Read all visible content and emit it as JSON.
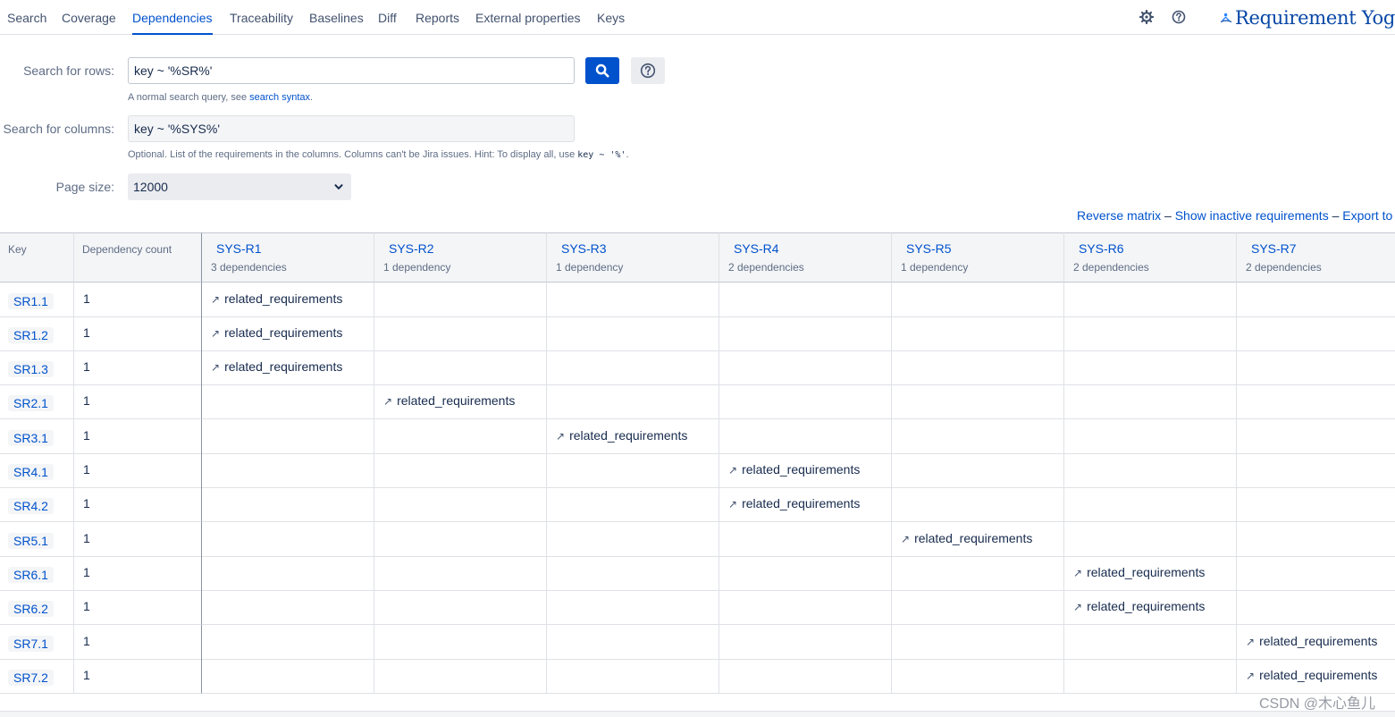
{
  "nav": {
    "tabs": [
      {
        "label": "Search",
        "active": false
      },
      {
        "label": "Coverage",
        "active": false
      },
      {
        "label": "Dependencies",
        "active": true
      },
      {
        "label": "Traceability",
        "active": false
      },
      {
        "label": "Baselines",
        "active": false
      },
      {
        "label": "Diff",
        "active": false
      },
      {
        "label": "Reports",
        "active": false
      },
      {
        "label": "External properties",
        "active": false
      },
      {
        "label": "Keys",
        "active": false
      }
    ],
    "icons": [
      "gear-icon",
      "help-icon"
    ],
    "brand": "Requirement Yog"
  },
  "form": {
    "rows_label": "Search for rows:",
    "rows_value": "key ~ '%SR%'",
    "rows_hint_prefix": "A normal search query, see ",
    "rows_hint_link": "search syntax",
    "rows_hint_suffix": ".",
    "columns_label": "Search for columns:",
    "columns_value": "key ~ '%SYS%'",
    "columns_hint_prefix": "Optional. List of the requirements in the columns. Columns can't be Jira issues. Hint: To display all, use ",
    "columns_hint_code": "key ~ '%'",
    "columns_hint_suffix": ".",
    "page_size_label": "Page size:",
    "page_size_value": "12000"
  },
  "actions": {
    "reverse": "Reverse matrix",
    "inactive": "Show inactive requirements",
    "export": "Export to E",
    "separator": "–"
  },
  "matrix": {
    "key_header": "Key",
    "count_header": "Dependency count",
    "relation_label": "related_requirements",
    "columns": [
      {
        "key": "SYS-R1",
        "deps": "3 dependencies"
      },
      {
        "key": "SYS-R2",
        "deps": "1 dependency"
      },
      {
        "key": "SYS-R3",
        "deps": "1 dependency"
      },
      {
        "key": "SYS-R4",
        "deps": "2 dependencies"
      },
      {
        "key": "SYS-R5",
        "deps": "1 dependency"
      },
      {
        "key": "SYS-R6",
        "deps": "2 dependencies"
      },
      {
        "key": "SYS-R7",
        "deps": "2 dependencies"
      }
    ],
    "rows": [
      {
        "key": "SR1.1",
        "count": "1",
        "col": 0
      },
      {
        "key": "SR1.2",
        "count": "1",
        "col": 0
      },
      {
        "key": "SR1.3",
        "count": "1",
        "col": 0
      },
      {
        "key": "SR2.1",
        "count": "1",
        "col": 1
      },
      {
        "key": "SR3.1",
        "count": "1",
        "col": 2
      },
      {
        "key": "SR4.1",
        "count": "1",
        "col": 3
      },
      {
        "key": "SR4.2",
        "count": "1",
        "col": 3
      },
      {
        "key": "SR5.1",
        "count": "1",
        "col": 4
      },
      {
        "key": "SR6.1",
        "count": "1",
        "col": 5
      },
      {
        "key": "SR6.2",
        "count": "1",
        "col": 5
      },
      {
        "key": "SR7.1",
        "count": "1",
        "col": 6
      },
      {
        "key": "SR7.2",
        "count": "1",
        "col": 6
      }
    ]
  },
  "watermark": "CSDN @木心鱼儿",
  "colors": {
    "accent": "#0052cc",
    "header_bg": "#f4f5f7",
    "border": "#dfe1e6"
  }
}
